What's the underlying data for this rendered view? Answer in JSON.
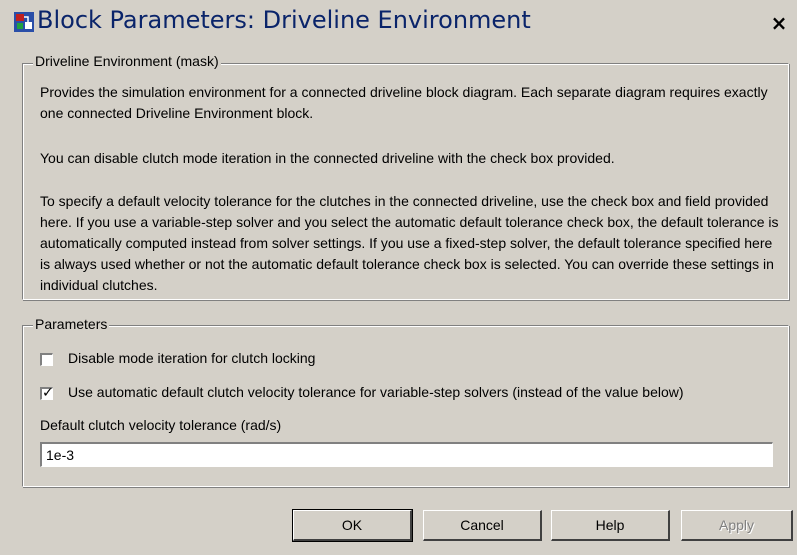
{
  "window": {
    "title": "Block Parameters: Driveline Environment",
    "close_symbol": "×"
  },
  "description": {
    "group_label": "Driveline Environment (mask)",
    "paragraphs": [
      "Provides the simulation environment for a connected driveline block diagram. Each separate diagram requires exactly one connected Driveline Environment block.",
      "You can disable clutch mode iteration in the connected driveline with the check box provided.",
      "To specify a default velocity tolerance for the clutches in the connected driveline, use the check box and field provided here. If you use a variable-step solver and you select the automatic default tolerance check box, the default tolerance is automatically computed instead from solver settings. If you use a fixed-step solver, the default tolerance specified here is always used whether or not the automatic default tolerance check box is selected. You can override these settings in individual clutches."
    ]
  },
  "parameters": {
    "group_label": "Parameters",
    "disable_mode_iteration": {
      "label": "Disable mode iteration for clutch locking",
      "checked": false
    },
    "use_auto_tolerance": {
      "label": "Use automatic default clutch velocity tolerance for variable-step solvers (instead of the value below)",
      "checked": true
    },
    "tolerance_label": "Default clutch velocity tolerance (rad/s)",
    "tolerance_value": "1e-3"
  },
  "buttons": {
    "ok": "OK",
    "cancel": "Cancel",
    "help": "Help",
    "apply": "Apply"
  },
  "icons": {
    "app": "simulink-block-icon",
    "close": "close-icon",
    "check": "checkmark-icon"
  }
}
